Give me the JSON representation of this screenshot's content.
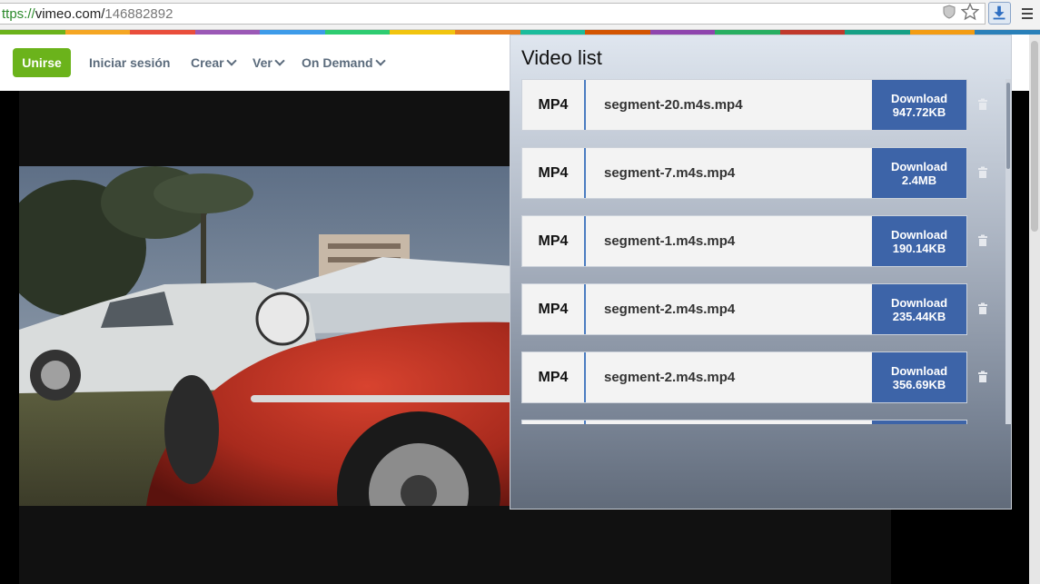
{
  "browser": {
    "url_scheme": "ttps://",
    "url_host": "vimeo.com/",
    "url_path": "146882892"
  },
  "brand_strip_colors": [
    "#6bb31b",
    "#f5a623",
    "#e94e3c",
    "#9b59b6",
    "#3d9be9",
    "#2ecc71",
    "#f1c40f",
    "#e67e22",
    "#1abc9c",
    "#d35400",
    "#8e44ad",
    "#27ae60",
    "#c0392b",
    "#16a085",
    "#f39c12",
    "#2980b9"
  ],
  "nav": {
    "join_label": "Unirse",
    "login_label": "Iniciar sesión",
    "create_label": "Crear",
    "watch_label": "Ver",
    "ondemand_label": "On Demand"
  },
  "popup": {
    "title": "Video list",
    "items": [
      {
        "format": "MP4",
        "filename": "segment-20.m4s.mp4",
        "download_label": "Download",
        "size": "947.72KB"
      },
      {
        "format": "MP4",
        "filename": "segment-7.m4s.mp4",
        "download_label": "Download",
        "size": "2.4MB"
      },
      {
        "format": "MP4",
        "filename": "segment-1.m4s.mp4",
        "download_label": "Download",
        "size": "190.14KB"
      },
      {
        "format": "MP4",
        "filename": "segment-2.m4s.mp4",
        "download_label": "Download",
        "size": "235.44KB"
      },
      {
        "format": "MP4",
        "filename": "segment-2.m4s.mp4",
        "download_label": "Download",
        "size": "356.69KB"
      }
    ]
  },
  "colors": {
    "accent_green": "#6bb31b",
    "download_blue": "#3d64a8",
    "nav_text": "#5b6b7c"
  }
}
